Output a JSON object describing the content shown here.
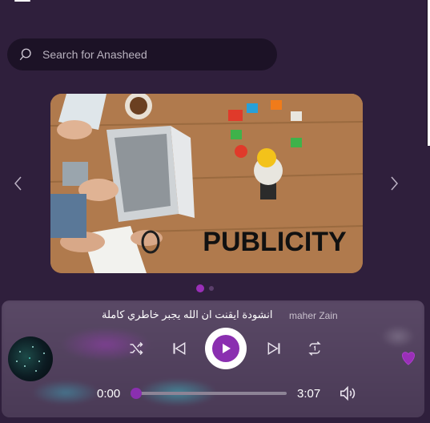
{
  "header": {
    "menu_icon": "hamburger-menu-icon"
  },
  "search": {
    "placeholder": "Search for Anasheed",
    "icon": "search-icon"
  },
  "carousel": {
    "slide_text": "PUBLICITY",
    "prev_icon": "chevron-left-icon",
    "next_icon": "chevron-right-icon",
    "active_index": 0,
    "slide_count": 2
  },
  "player": {
    "track_title": "انشودة ايقنت ان الله يجبر خاطري كاملة",
    "artist": "maher Zain",
    "current_time": "0:00",
    "total_time": "3:07",
    "progress": 0,
    "accent_color": "#8a2fb0",
    "icons": {
      "shuffle": "shuffle-icon",
      "previous": "skip-previous-icon",
      "play": "play-icon",
      "next": "skip-next-icon",
      "repeat": "repeat-one-icon",
      "favorite": "heart-icon",
      "volume": "volume-icon"
    }
  }
}
